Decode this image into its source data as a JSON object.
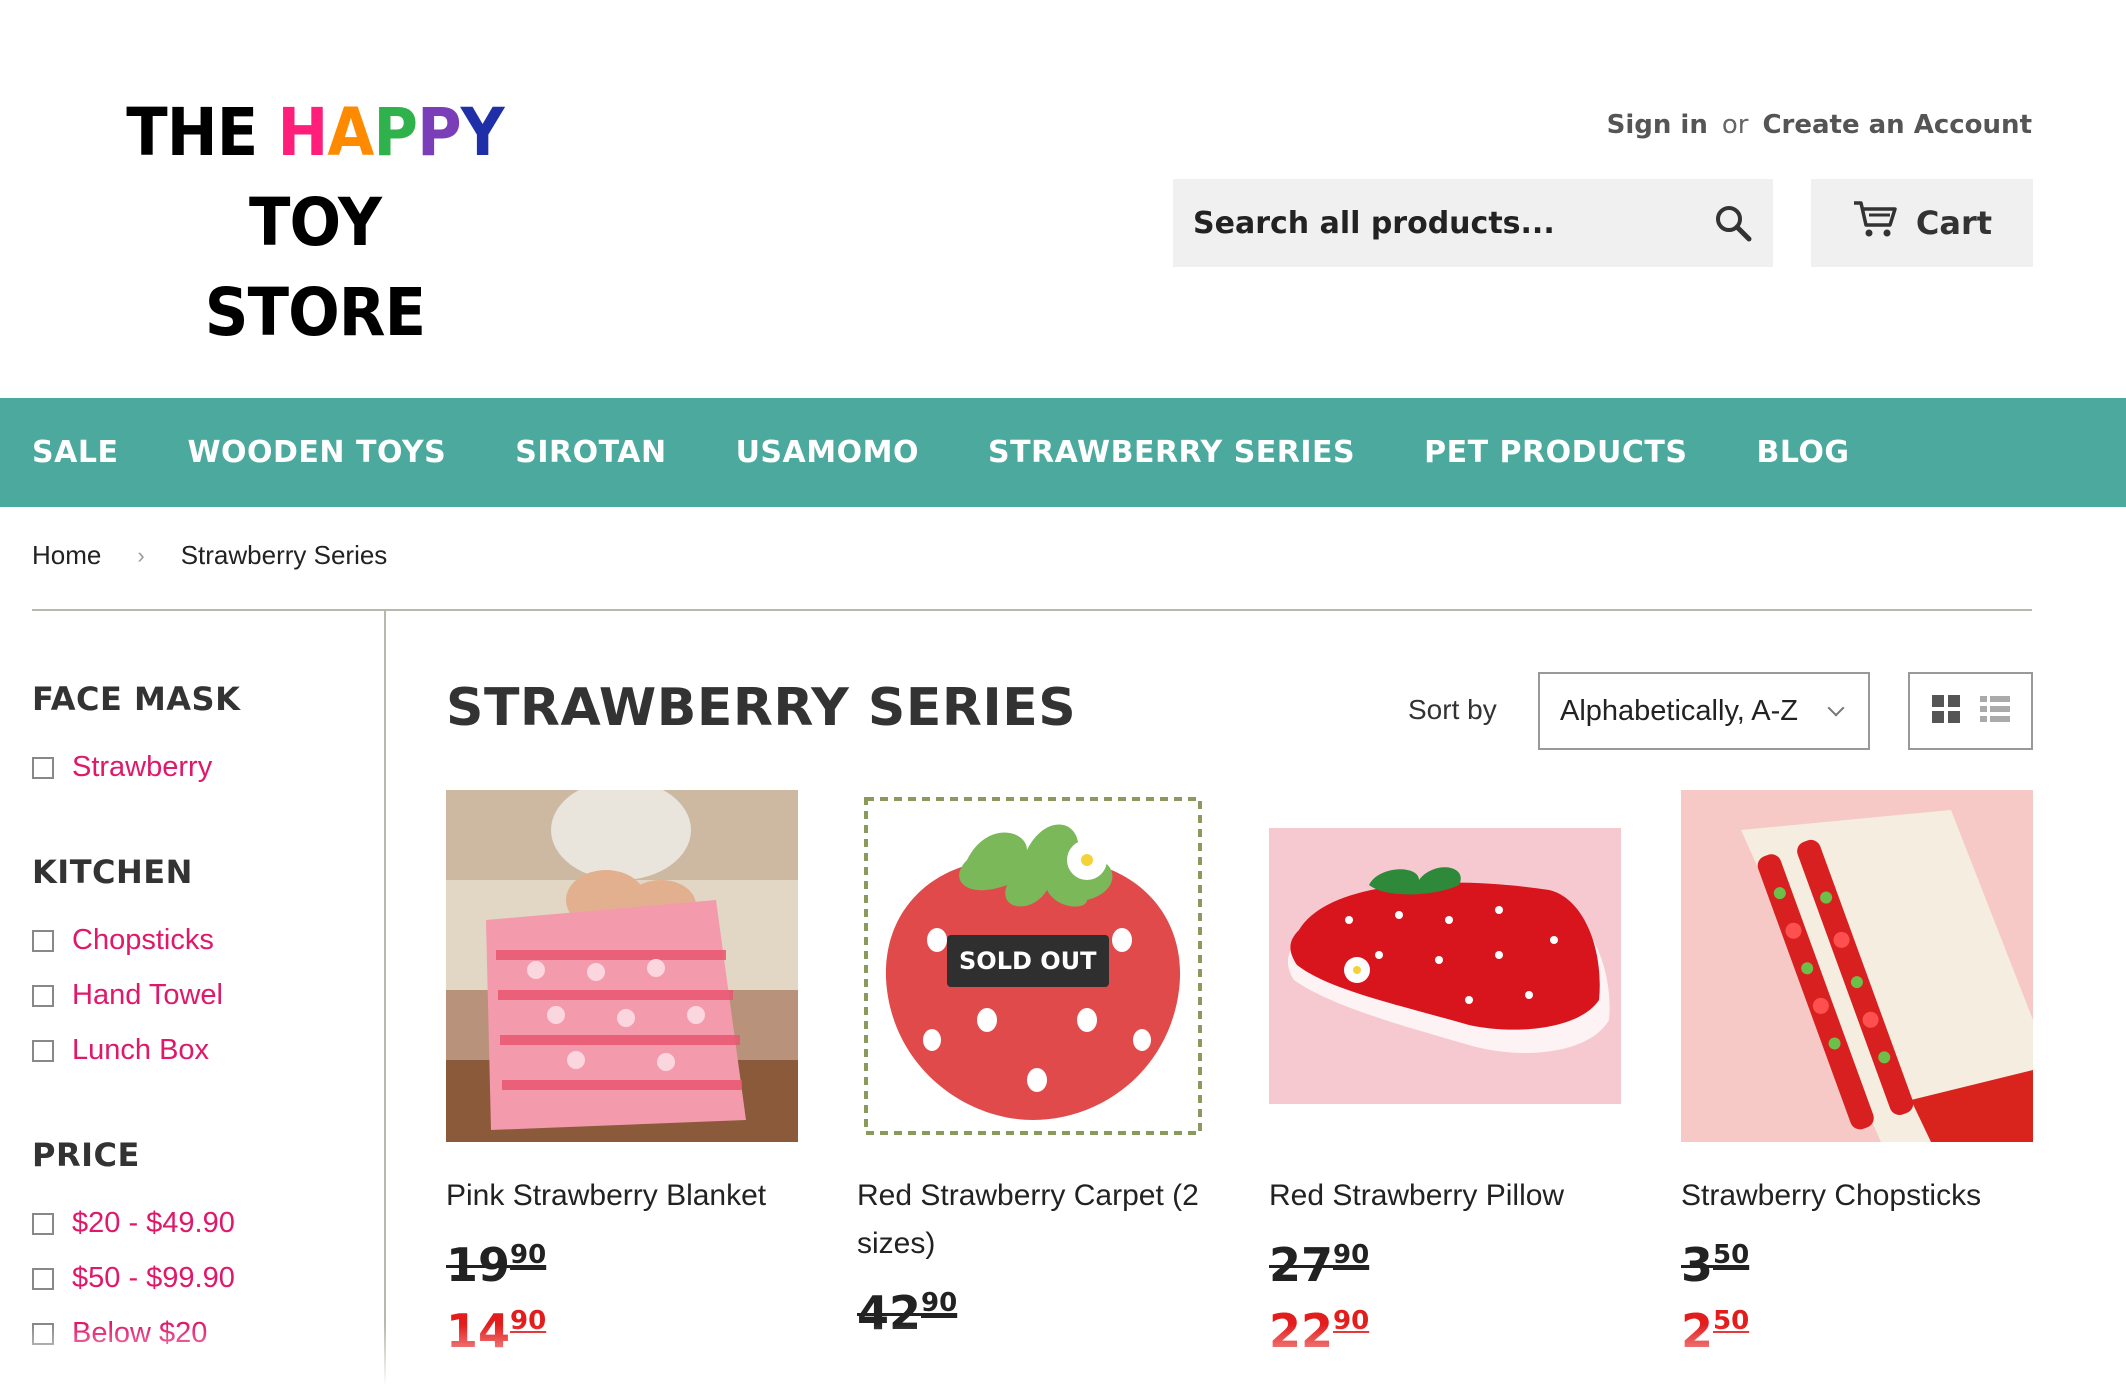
{
  "store": {
    "logo_line1_parts": [
      {
        "text": "THE ",
        "color": "#000000"
      },
      {
        "text": "H",
        "color": "#ff1e7a"
      },
      {
        "text": "A",
        "color": "#ff8a00"
      },
      {
        "text": "P",
        "color": "#2fb14b"
      },
      {
        "text": "P",
        "color": "#7a3fb8"
      },
      {
        "text": "Y",
        "color": "#1e2fa8"
      },
      {
        "text": " TOY",
        "color": "#000000"
      }
    ],
    "logo_line2": "STORE"
  },
  "account": {
    "sign_in": "Sign in",
    "or": "or",
    "create": "Create an Account"
  },
  "search": {
    "placeholder": "Search all products..."
  },
  "cart": {
    "label": "Cart"
  },
  "nav": [
    "SALE",
    "WOODEN TOYS",
    "SIROTAN",
    "USAMOMO",
    "STRAWBERRY SERIES",
    "PET PRODUCTS",
    "BLOG"
  ],
  "breadcrumb": {
    "home": "Home",
    "sep": "›",
    "current": "Strawberry Series"
  },
  "filters": [
    {
      "title": "FACE MASK",
      "options": [
        "Strawberry"
      ]
    },
    {
      "title": "KITCHEN",
      "options": [
        "Chopsticks",
        "Hand Towel",
        "Lunch Box"
      ]
    },
    {
      "title": "PRICE",
      "options": [
        "$20 - $49.90",
        "$50 - $99.90",
        "Below $20"
      ]
    }
  ],
  "collection": {
    "title": "STRAWBERRY SERIES",
    "sort_label": "Sort by",
    "sort_value": "Alphabetically, A-Z"
  },
  "products": [
    {
      "name": "Pink Strawberry Blanket",
      "old_int": "19",
      "old_dec": "90",
      "new_int": "14",
      "new_dec": "90",
      "sold_out": ""
    },
    {
      "name": "Red Strawberry Carpet (2 sizes)",
      "old_int": "42",
      "old_dec": "90",
      "new_int": "",
      "new_dec": "",
      "sold_out": "SOLD OUT"
    },
    {
      "name": "Red Strawberry Pillow",
      "old_int": "27",
      "old_dec": "90",
      "new_int": "22",
      "new_dec": "90",
      "sold_out": ""
    },
    {
      "name": "Strawberry Chopsticks",
      "old_int": "3",
      "old_dec": "50",
      "new_int": "2",
      "new_dec": "50",
      "sold_out": ""
    }
  ],
  "colors": {
    "nav_bg": "#4ba99e",
    "link_pink": "#e0186a",
    "sale_red": "#e31c1c"
  }
}
